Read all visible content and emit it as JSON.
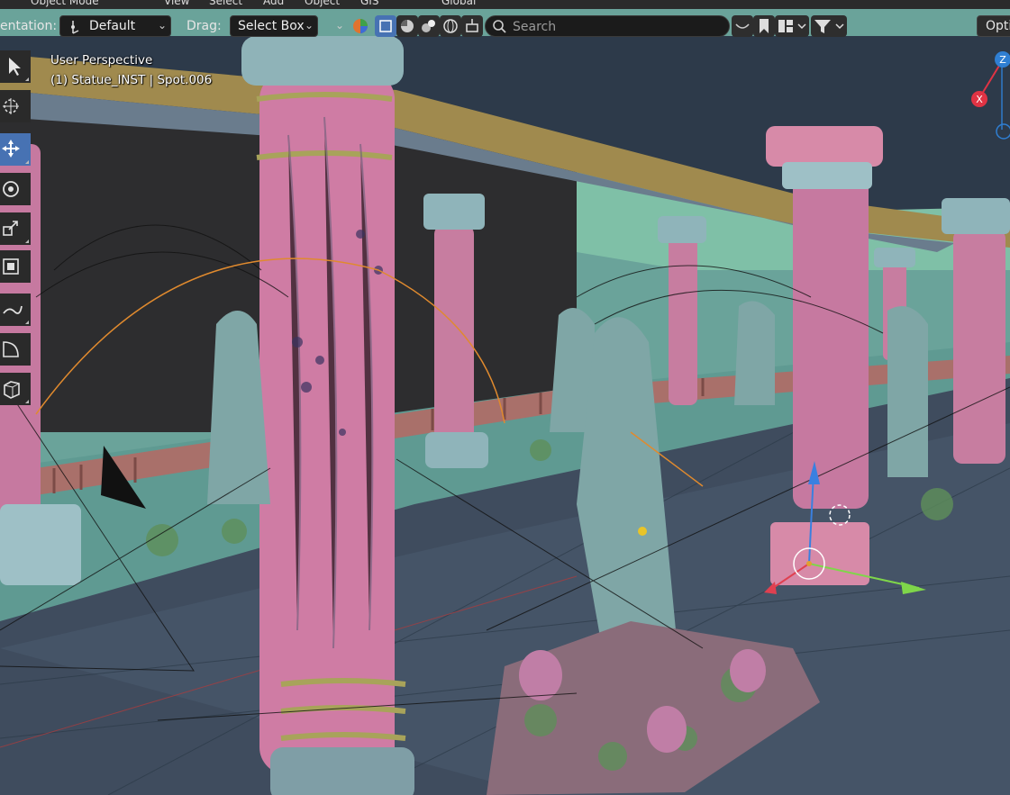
{
  "top_menu": {
    "mode": "Object Mode",
    "items": [
      "View",
      "Select",
      "Add",
      "Object",
      "GIS"
    ],
    "transform_orientation": "Global"
  },
  "tool_header": {
    "orientation_label": "entation:",
    "orientation_value": "Default",
    "drag_label": "Drag:",
    "drag_value": "Select Box",
    "search_placeholder": "Search",
    "options_label": "Opti"
  },
  "toolbar": {
    "tools": [
      "select-box",
      "cursor",
      "move",
      "rotate",
      "scale",
      "transform",
      "annotate",
      "measure",
      "add-cube"
    ],
    "active_tool": "move"
  },
  "viewport_overlay": {
    "perspective": "User Perspective",
    "object_info": "(1) Statue_INST | Spot.006"
  },
  "gizmo": {
    "z_label": "Z",
    "x_label": "X"
  },
  "colors": {
    "header_bg": "#2b2b2b",
    "active_blue": "#4772b3",
    "gizmo_x": "#e03344",
    "gizmo_z": "#2f7fd3"
  }
}
